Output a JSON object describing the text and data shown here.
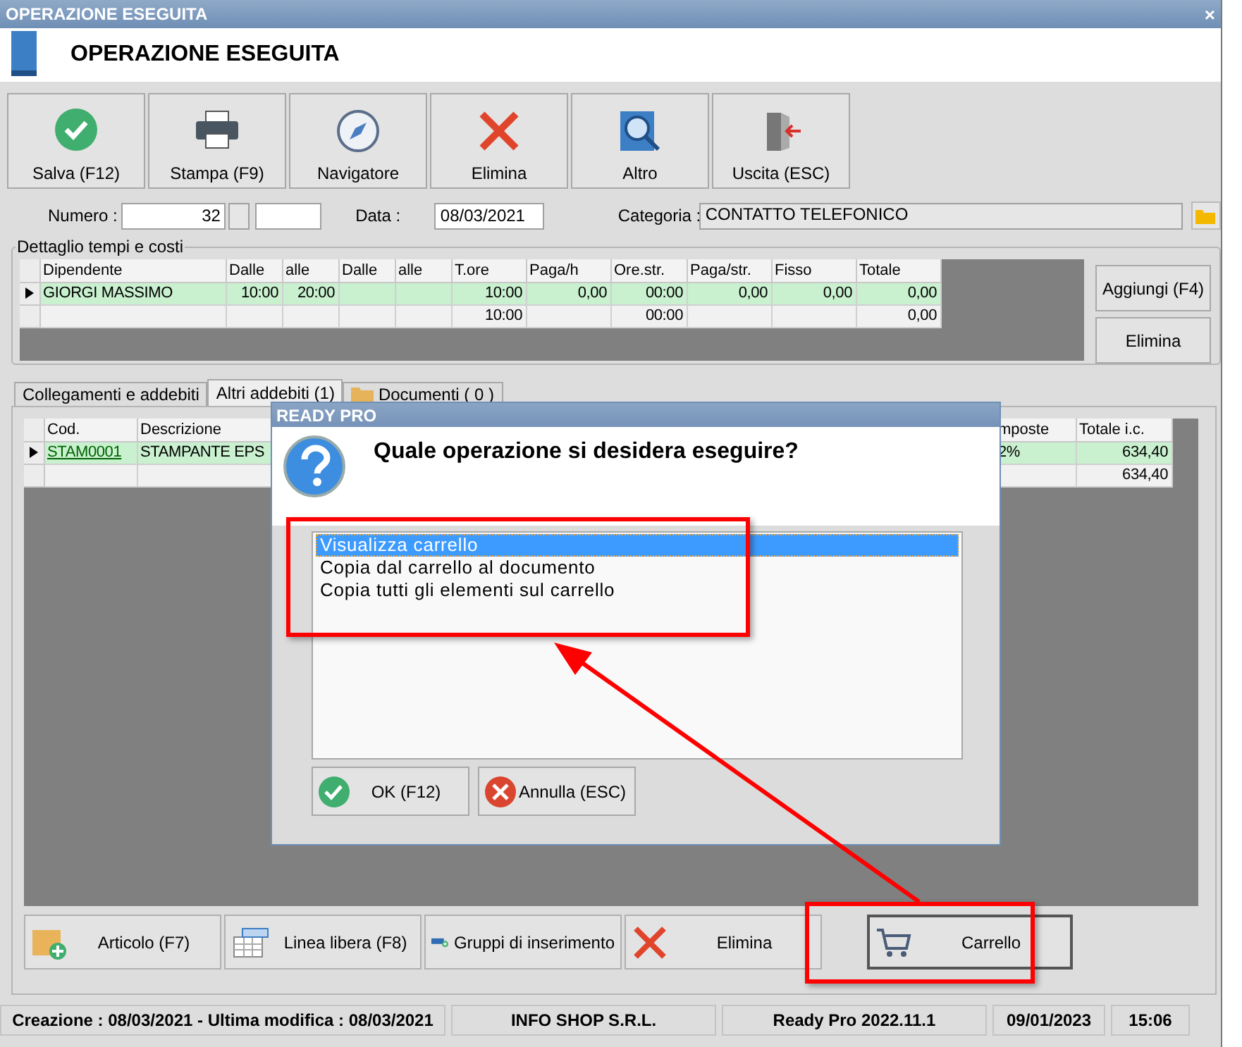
{
  "window": {
    "title": "OPERAZIONE ESEGUITA",
    "close": "×",
    "header": "OPERAZIONE ESEGUITA"
  },
  "toolbar": [
    {
      "label": "Salva (F12)",
      "kind": "save"
    },
    {
      "label": "Stampa (F9)",
      "kind": "print"
    },
    {
      "label": "Navigatore",
      "kind": "navigator"
    },
    {
      "label": "Elimina",
      "kind": "delete"
    },
    {
      "label": "Altro",
      "kind": "more"
    },
    {
      "label": "Uscita (ESC)",
      "kind": "exit"
    }
  ],
  "fields": {
    "numero_label": "Numero :",
    "numero": "32",
    "data_label": "Data :",
    "data": "08/03/2021",
    "categoria_label": "Categoria :",
    "categoria": "CONTATTO TELEFONICO"
  },
  "times": {
    "title": "Dettaglio tempi e costi",
    "columns": [
      "Dipendente",
      "Dalle",
      "alle",
      "Dalle",
      "alle",
      "T.ore",
      "Paga/h",
      "Ore.str.",
      "Paga/str.",
      "Fisso",
      "Totale"
    ],
    "rows": [
      {
        "selected": true,
        "cells": [
          "GIORGI MASSIMO",
          "10:00",
          "20:00",
          null,
          null,
          "10:00",
          "0,00",
          "00:00",
          "0,00",
          "0,00",
          "0,00"
        ]
      },
      {
        "selected": false,
        "cells": [
          null,
          null,
          null,
          null,
          null,
          "10:00",
          null,
          "00:00",
          null,
          null,
          "0,00"
        ]
      }
    ],
    "buttons": [
      "Aggiungi (F4)",
      "Elimina"
    ]
  },
  "tabs": [
    {
      "label": "Collegamenti e addebiti",
      "selected": false,
      "kind": "plain"
    },
    {
      "label": "Altri addebiti (1)",
      "selected": true,
      "kind": "plain"
    },
    {
      "label": "Documenti ( 0 )",
      "selected": false,
      "kind": "folder"
    }
  ],
  "items": {
    "columns": [
      "Cod.",
      "Descrizione",
      "mposte",
      "Totale i.c."
    ],
    "rows": [
      {
        "selected": true,
        "cells": [
          "STAM0001",
          "STAMPANTE EPS",
          "2%",
          "634,40"
        ]
      },
      {
        "selected": false,
        "cells": [
          null,
          null,
          null,
          "634,40"
        ]
      }
    ]
  },
  "bottom_buttons": [
    {
      "label": "Articolo (F7)",
      "kind": "article"
    },
    {
      "label": "Linea libera (F8)",
      "kind": "line"
    },
    {
      "label": "Gruppi di inserimento",
      "kind": "group"
    },
    {
      "label": "Elimina",
      "kind": "delete"
    },
    {
      "label": "Carrello",
      "kind": "cart"
    }
  ],
  "status_bar": [
    "Creazione : 08/03/2021 - Ultima modifica : 08/03/2021",
    "INFO SHOP S.R.L.",
    "Ready Pro 2022.11.1",
    "09/01/2023",
    "15:06"
  ],
  "dialog": {
    "title": "READY PRO",
    "question": "Quale operazione si desidera eseguire?",
    "options": [
      {
        "label": "Visualizza carrello",
        "selected": true
      },
      {
        "label": "Copia dal carrello al documento",
        "selected": false
      },
      {
        "label": "Copia tutti gli elementi sul carrello",
        "selected": false
      }
    ],
    "buttons": [
      {
        "label": "OK (F12)",
        "kind": "ok"
      },
      {
        "label": "Annulla (ESC)",
        "kind": "cancel"
      }
    ]
  }
}
